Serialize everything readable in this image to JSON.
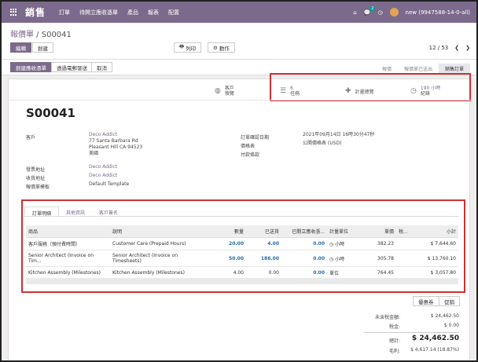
{
  "navbar": {
    "brand": "銷售",
    "menu": [
      "訂單",
      "待開立應收憑單",
      "產品",
      "報表",
      "配置"
    ],
    "chat_count": "2",
    "user": "new (9947588-14-0-all)"
  },
  "control": {
    "breadcrumb_parent": "報價單",
    "breadcrumb_sep": " / ",
    "breadcrumb_current": "S00041",
    "edit_label": "編輯",
    "create_label": "創建",
    "print_label": "列印",
    "action_label": "動作",
    "pager": "12 / 53"
  },
  "statusbar": {
    "create_invoice": "創建應收憑單",
    "send_email": "透過電郵發送",
    "cancel": "取消",
    "stages": [
      "報價",
      "報價單已送出",
      "銷售訂單"
    ]
  },
  "smart_buttons": {
    "customer_preview_1": "客戶",
    "customer_preview_2": "預覽",
    "tasks_count": "6",
    "tasks_label": "任務",
    "project_overview": "計畫總覽",
    "timesheet_value": "190 小時",
    "timesheet_label": "紀錄"
  },
  "order": {
    "name": "S00041",
    "customer_label": "客戶",
    "customer_name": "Deco Addict",
    "address_1": "77 Santa Barbara Rd",
    "address_2": "Pleasant Hill CA 94523",
    "address_3": "美國",
    "invoice_addr_label": "發票地址",
    "invoice_addr": "Deco Addict",
    "delivery_addr_label": "收貨地址",
    "delivery_addr": "Deco Addict",
    "template_label": "報價單模板",
    "template": "Default Template",
    "confirm_date_label": "訂單確認日期",
    "confirm_date": "2021年09月14日 16時30分47秒",
    "pricelist_label": "價格表",
    "pricelist": "公開價格表 (USD)",
    "payment_terms_label": "付款條款"
  },
  "tabs": [
    "訂單明細",
    "其他資訊",
    "客戶簽名"
  ],
  "table": {
    "headers": [
      "商品",
      "說明",
      "數量",
      "已送貨",
      "已開立應收憑...",
      "計量單位",
      "單價",
      "稅...",
      "小計"
    ],
    "rows": [
      {
        "product": "客戶服務（預付費時間）",
        "desc": "Customer Care (Prepaid Hours)",
        "desc2": "",
        "qty": "20.00",
        "delivered": "4.00",
        "invoiced": "0.00",
        "uom": "小時",
        "price": "382.23",
        "tax": "",
        "subtotal": "$ 7,644.60"
      },
      {
        "product": "Senior Architect (Invoice on Tim...",
        "desc": "Senior Architect (Invoice on",
        "desc2": "Timesheets)",
        "qty": "50.00",
        "delivered": "186.00",
        "invoiced": "0.00",
        "uom": "小時",
        "price": "305.78",
        "tax": "",
        "subtotal": "$ 13,760.10"
      },
      {
        "product": "Kitchen Assembly (Milestones)",
        "desc": "Kitchen Assembly (Milestones)",
        "desc2": "",
        "qty": "4.00",
        "delivered": "0.00",
        "invoiced": "0.00",
        "uom": "單位",
        "price": "764.45",
        "tax": "",
        "subtotal": "$ 3,057.80"
      }
    ]
  },
  "coupon": {
    "coupon_label": "優惠券",
    "promo_label": "促銷"
  },
  "totals": {
    "untaxed_label": "未含稅金額:",
    "untaxed": "$ 24,462.50",
    "tax_label": "稅金:",
    "tax": "$ 0.00",
    "total_label": "總計:",
    "total": "$ 24,462.50",
    "margin_label": "毛利:",
    "margin": "$ 4,617.14 (18.87%)"
  },
  "colors": {
    "brand": "#7c6a8c",
    "highlight_box": "#d32f2f",
    "teal": "#00a09d"
  }
}
